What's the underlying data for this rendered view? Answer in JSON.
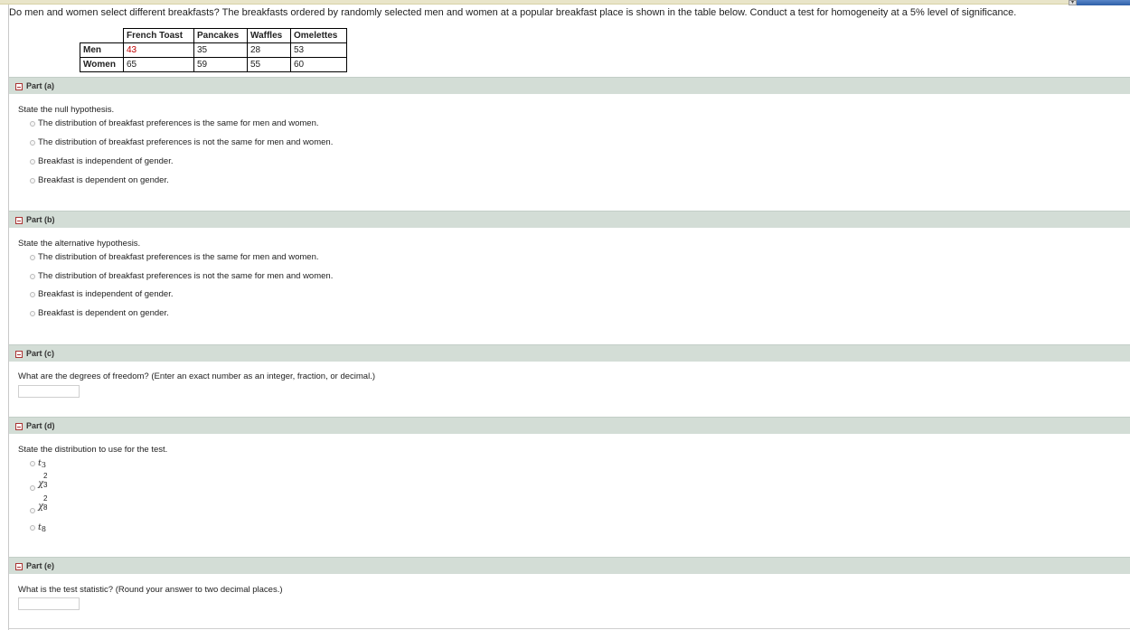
{
  "question": "Do men and women select different breakfasts? The breakfasts ordered by randomly selected men and women at a popular breakfast place is shown in the table below. Conduct a test for homogeneity at a 5% level of significance.",
  "table": {
    "headers": [
      "French Toast",
      "Pancakes",
      "Waffles",
      "Omelettes"
    ],
    "rows": [
      {
        "label": "Men",
        "values": [
          "43",
          "35",
          "28",
          "53"
        ]
      },
      {
        "label": "Women",
        "values": [
          "65",
          "59",
          "55",
          "60"
        ]
      }
    ]
  },
  "part_a": {
    "title": "Part (a)",
    "prompt": "State the null hypothesis.",
    "options": [
      "The distribution of breakfast preferences is the same for men and women.",
      "The distribution of breakfast preferences is not the same for men and women.",
      "Breakfast is independent of gender.",
      "Breakfast is dependent on gender."
    ]
  },
  "part_b": {
    "title": "Part (b)",
    "prompt": "State the alternative hypothesis.",
    "options": [
      "The distribution of breakfast preferences is the same for men and women.",
      "The distribution of breakfast preferences is not the same for men and women.",
      "Breakfast is independent of gender.",
      "Breakfast is dependent on gender."
    ]
  },
  "part_c": {
    "title": "Part (c)",
    "prompt": "What are the degrees of freedom? (Enter an exact number as an integer, fraction, or decimal.)"
  },
  "part_d": {
    "title": "Part (d)",
    "prompt": "State the distribution to use for the test.",
    "options": [
      {
        "sym": "t",
        "sup": "",
        "sub": "3"
      },
      {
        "sym": "χ",
        "sup": "2",
        "sub": "3"
      },
      {
        "sym": "χ",
        "sup": "2",
        "sub": "8"
      },
      {
        "sym": "t",
        "sup": "",
        "sub": "8"
      }
    ]
  },
  "part_e": {
    "title": "Part (e)",
    "prompt": "What is the test statistic? (Round your answer to two decimal places.)"
  },
  "colors": {
    "part_header_bg": "#d3ddd6",
    "highlight_value": "#c00000"
  }
}
